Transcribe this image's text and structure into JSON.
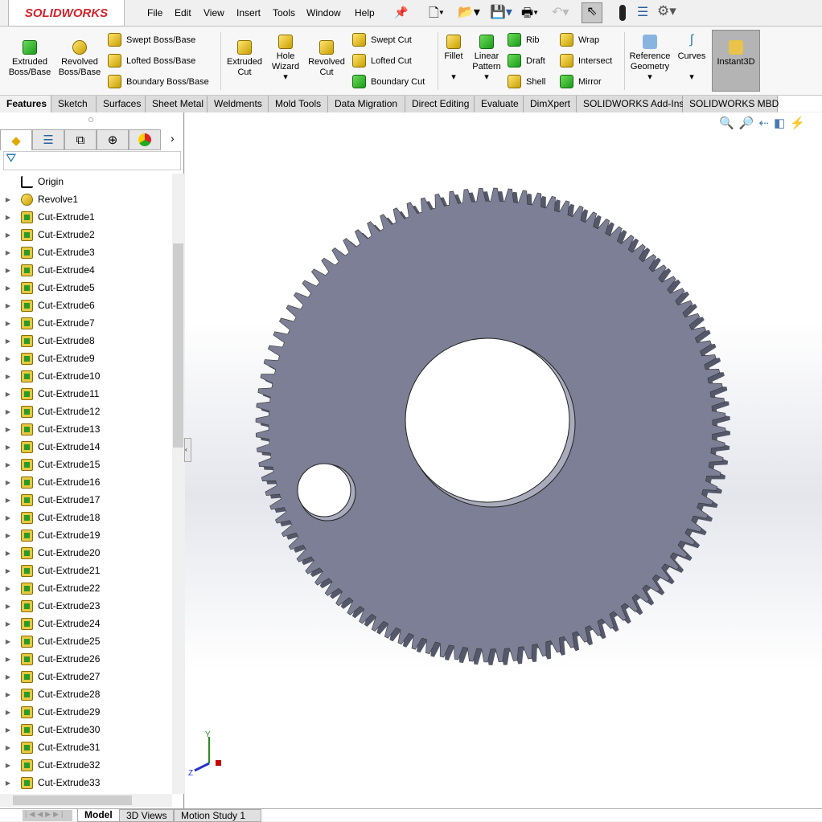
{
  "app": {
    "logo": "SOLIDWORKS"
  },
  "menu": [
    "File",
    "Edit",
    "View",
    "Insert",
    "Tools",
    "Window",
    "Help"
  ],
  "ribbon": {
    "large": [
      {
        "label": "Extruded\nBoss/Base"
      },
      {
        "label": "Revolved\nBoss/Base"
      },
      {
        "label": "Extruded\nCut"
      },
      {
        "label": "Hole\nWizard"
      },
      {
        "label": "Revolved\nCut"
      },
      {
        "label": "Fillet"
      },
      {
        "label": "Linear\nPattern"
      },
      {
        "label": "Reference\nGeometry"
      },
      {
        "label": "Curves"
      },
      {
        "label": "Instant3D"
      }
    ],
    "small": [
      "Swept Boss/Base",
      "Lofted Boss/Base",
      "Boundary Boss/Base",
      "Swept Cut",
      "Lofted Cut",
      "Boundary Cut",
      "Rib",
      "Draft",
      "Shell",
      "Wrap",
      "Intersect",
      "Mirror"
    ]
  },
  "tabs": [
    "Features",
    "Sketch",
    "Surfaces",
    "Sheet Metal",
    "Weldments",
    "Mold Tools",
    "Data Migration",
    "Direct Editing",
    "Evaluate",
    "DimXpert",
    "SOLIDWORKS Add-Ins",
    "SOLIDWORKS MBD"
  ],
  "tree": [
    "Origin",
    "Revolve1",
    "Cut-Extrude1",
    "Cut-Extrude2",
    "Cut-Extrude3",
    "Cut-Extrude4",
    "Cut-Extrude5",
    "Cut-Extrude6",
    "Cut-Extrude7",
    "Cut-Extrude8",
    "Cut-Extrude9",
    "Cut-Extrude10",
    "Cut-Extrude11",
    "Cut-Extrude12",
    "Cut-Extrude13",
    "Cut-Extrude14",
    "Cut-Extrude15",
    "Cut-Extrude16",
    "Cut-Extrude17",
    "Cut-Extrude18",
    "Cut-Extrude19",
    "Cut-Extrude20",
    "Cut-Extrude21",
    "Cut-Extrude22",
    "Cut-Extrude23",
    "Cut-Extrude24",
    "Cut-Extrude25",
    "Cut-Extrude26",
    "Cut-Extrude27",
    "Cut-Extrude28",
    "Cut-Extrude29",
    "Cut-Extrude30",
    "Cut-Extrude31",
    "Cut-Extrude32",
    "Cut-Extrude33"
  ],
  "bottom_tabs": [
    "Model",
    "3D Views",
    "Motion Study 1"
  ],
  "triad": {
    "y": "Y",
    "z": "Z"
  },
  "colors": {
    "gear": "#7c7f95",
    "accent": "#d2232a"
  }
}
